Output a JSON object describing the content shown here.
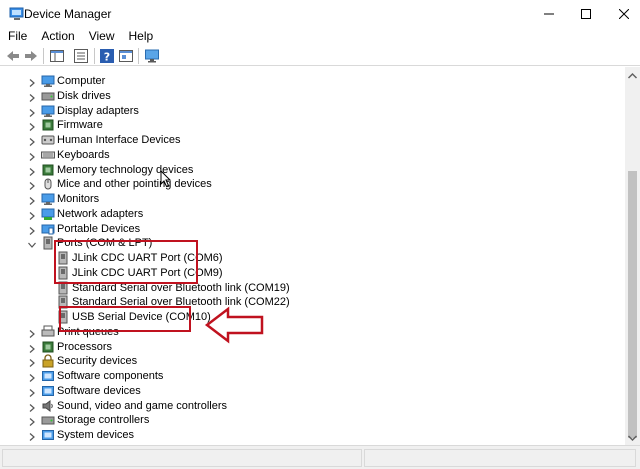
{
  "window": {
    "title": "Device Manager"
  },
  "menu": [
    "File",
    "Action",
    "View",
    "Help"
  ],
  "toolbar": {
    "icons": [
      "back-arrow-icon",
      "forward-arrow-icon",
      "properties-pane-icon",
      "device-list-icon",
      "help-icon",
      "scan-hardware-icon",
      "monitor-icon"
    ]
  },
  "tree": {
    "items": [
      {
        "label": "Computer",
        "icon": "computer-icon"
      },
      {
        "label": "Disk drives",
        "icon": "disk-drive-icon"
      },
      {
        "label": "Display adapters",
        "icon": "display-adapter-icon"
      },
      {
        "label": "Firmware",
        "icon": "firmware-icon"
      },
      {
        "label": "Human Interface Devices",
        "icon": "hid-icon"
      },
      {
        "label": "Keyboards",
        "icon": "keyboard-icon"
      },
      {
        "label": "Memory technology devices",
        "icon": "memory-icon"
      },
      {
        "label": "Mice and other pointing devices",
        "icon": "mouse-icon"
      },
      {
        "label": "Monitors",
        "icon": "monitor-icon"
      },
      {
        "label": "Network adapters",
        "icon": "network-adapter-icon"
      },
      {
        "label": "Portable Devices",
        "icon": "portable-device-icon"
      },
      {
        "label": "Ports (COM & LPT)",
        "icon": "port-icon",
        "expanded": true
      },
      {
        "label": "JLink CDC UART Port (COM6)",
        "icon": "port-icon",
        "child": true
      },
      {
        "label": "JLink CDC UART Port (COM9)",
        "icon": "port-icon",
        "child": true
      },
      {
        "label": "Standard Serial over Bluetooth link (COM19)",
        "icon": "port-icon",
        "child": true
      },
      {
        "label": "Standard Serial over Bluetooth link (COM22)",
        "icon": "port-icon",
        "child": true
      },
      {
        "label": "USB Serial Device (COM10)",
        "icon": "port-icon",
        "child": true
      },
      {
        "label": "Print queues",
        "icon": "printer-icon"
      },
      {
        "label": "Processors",
        "icon": "processor-icon"
      },
      {
        "label": "Security devices",
        "icon": "security-icon"
      },
      {
        "label": "Software components",
        "icon": "software-component-icon"
      },
      {
        "label": "Software devices",
        "icon": "software-device-icon"
      },
      {
        "label": "Sound, video and game controllers",
        "icon": "sound-icon"
      },
      {
        "label": "Storage controllers",
        "icon": "storage-icon"
      },
      {
        "label": "System devices",
        "icon": "system-device-icon"
      }
    ]
  },
  "colors": {
    "annotation": "#c0121f",
    "accent": "#0078d7"
  }
}
